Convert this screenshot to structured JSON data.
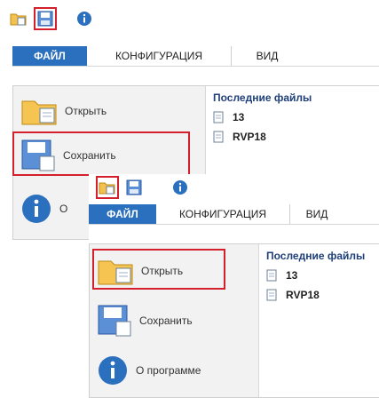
{
  "panel_top": {
    "tabs": {
      "file": "ФАЙЛ",
      "configuration": "КОНФИГУРАЦИЯ",
      "view": "ВИД"
    },
    "menu": {
      "open": "Открыть",
      "save": "Сохранить",
      "about_partial": "О"
    },
    "recent": {
      "title": "Последние файлы",
      "items": [
        "13",
        "RVP18"
      ]
    },
    "highlight": "save"
  },
  "panel_bottom": {
    "tabs": {
      "file": "ФАЙЛ",
      "configuration": "КОНФИГУРАЦИЯ",
      "view": "ВИД"
    },
    "menu": {
      "open": "Открыть",
      "save": "Сохранить",
      "about": "О программе"
    },
    "recent": {
      "title": "Последние файлы",
      "items": [
        "13",
        "RVP18"
      ]
    },
    "highlight": "open"
  },
  "colors": {
    "accent": "#2b6fbf",
    "highlight": "#d3202c",
    "title_text": "#1f3f7a"
  },
  "icons": [
    "open-folder-icon",
    "save-floppy-icon",
    "info-icon",
    "document-icon"
  ]
}
